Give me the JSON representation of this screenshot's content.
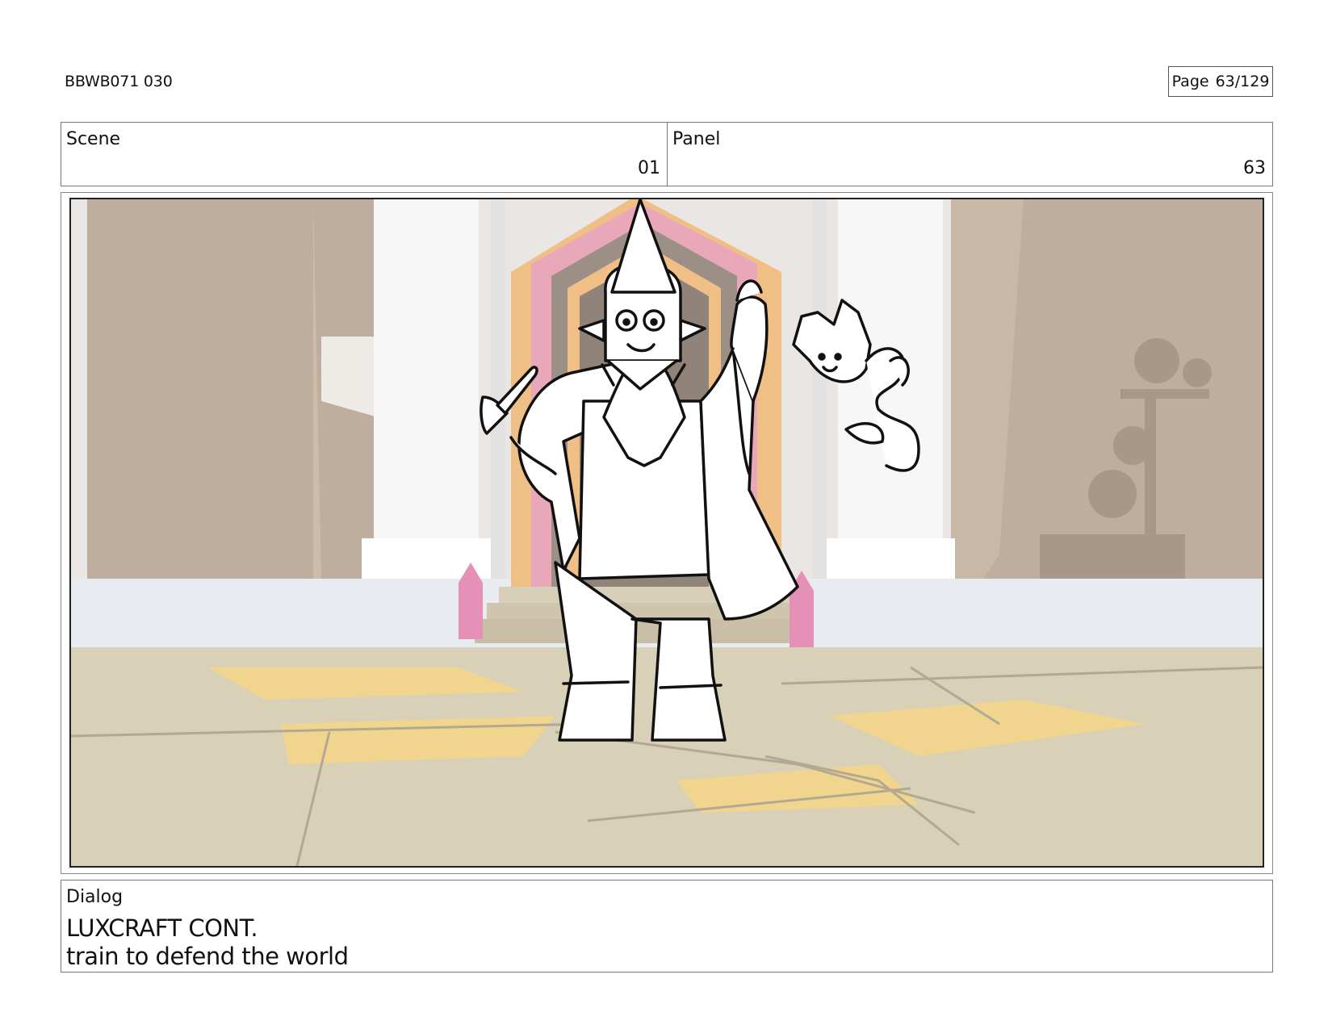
{
  "header": {
    "doc_id": "BBWB071 030",
    "page_label": "Page",
    "page_number": "63/129"
  },
  "scene": {
    "label": "Scene",
    "value": "01"
  },
  "panel": {
    "label": "Panel",
    "value": "63"
  },
  "frame": {
    "image_name": "storyboard-panel-drawing",
    "colors": {
      "wall": "#e9e6e3",
      "pillar": "#ffffff",
      "rock": "#bfad9e",
      "floor": "#d9d0b8",
      "floor_gold": "#f1d58f",
      "door_orange": "#efbf86",
      "door_pink": "#e9a8b9",
      "door_dark": "#9c8f86",
      "crystal": "#e590b7",
      "ink": "#111111"
    }
  },
  "dialog": {
    "label": "Dialog",
    "lines": [
      "LUXCRAFT CONT.",
      "train to defend the world"
    ]
  }
}
